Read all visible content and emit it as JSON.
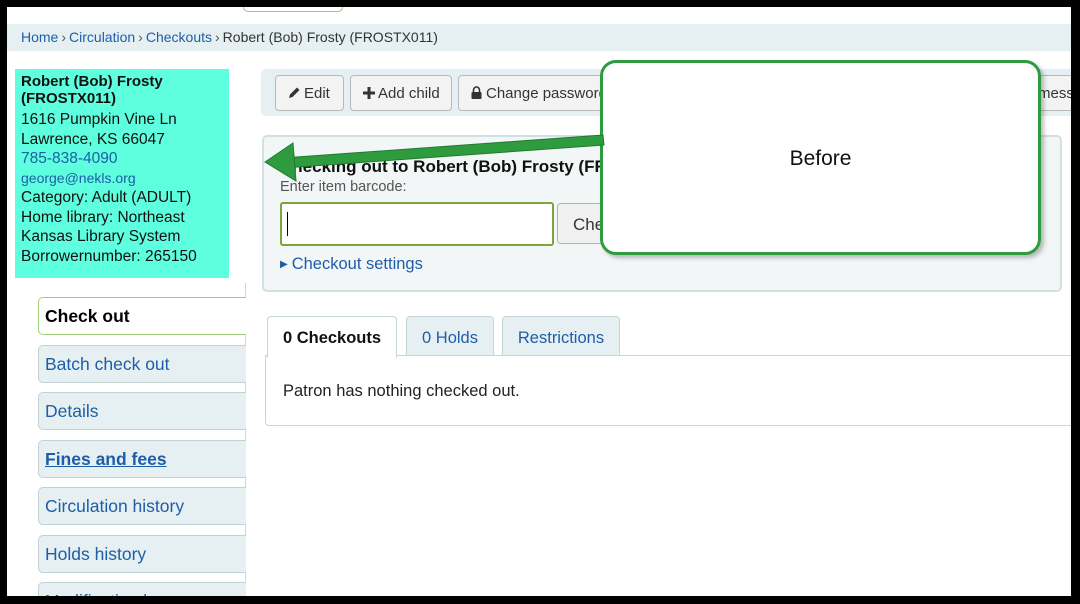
{
  "breadcrumb": {
    "items": [
      "Home",
      "Circulation",
      "Checkouts"
    ],
    "current": "Robert (Bob) Frosty (FROSTX011)",
    "separator": "›"
  },
  "patron": {
    "name": "Robert (Bob) Frosty (FROSTX011)",
    "address1": "1616 Pumpkin Vine Ln",
    "address2": "Lawrence, KS 66047",
    "phone": "785-838-4090",
    "email": "george@nekls.org",
    "category": "Category: Adult (ADULT)",
    "library_line1": "Home library: Northeast",
    "library_line2": "Kansas Library System",
    "borrowernumber": "Borrowernumber: 265150",
    "bg_color": "#5effde"
  },
  "toolbar": {
    "edit": "Edit",
    "add_child": "Add child",
    "change_password": "Change password",
    "cut_text": "mess"
  },
  "checkout": {
    "header": "Checking out to Robert (Bob) Frosty (FR",
    "barcode_label": "Enter item barcode:",
    "barcode_value": "",
    "check_button": "Che",
    "settings_link": "Checkout settings"
  },
  "tabs": [
    {
      "label": "0 Checkouts",
      "active": true
    },
    {
      "label": "0 Holds",
      "active": false
    },
    {
      "label": "Restrictions",
      "active": false
    }
  ],
  "tab_message": "Patron has nothing checked out.",
  "nav": [
    {
      "label": "Check out"
    },
    {
      "label": "Batch check out"
    },
    {
      "label": "Details"
    },
    {
      "label": "Fines and fees"
    },
    {
      "label": "Circulation history"
    },
    {
      "label": "Holds history"
    },
    {
      "label": "Modification log"
    }
  ],
  "callout": {
    "text": "Before",
    "border_color": "#2e9c3e"
  },
  "colors": {
    "link": "#1e5ea8",
    "arrow": "#2e9c3e",
    "input_border": "#7aa63a"
  }
}
